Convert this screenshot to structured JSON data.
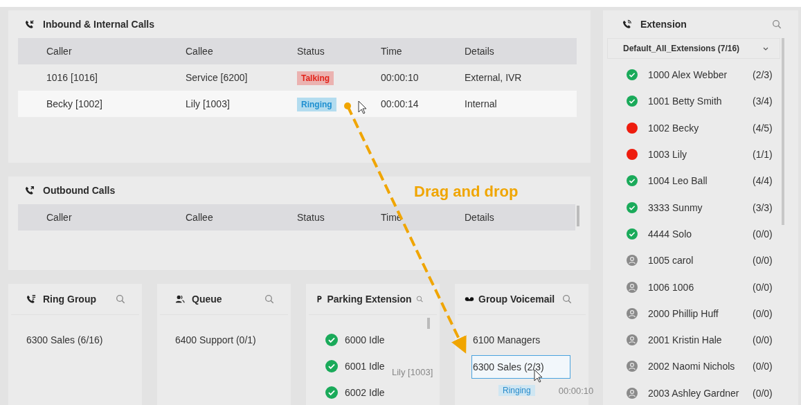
{
  "inbound": {
    "title": "Inbound & Internal Calls",
    "columns": [
      "Caller",
      "Callee",
      "Status",
      "Time",
      "Details"
    ],
    "rows": [
      {
        "caller": "1016 [1016]",
        "callee": "Service [6200]",
        "status": "Talking",
        "kind": "talking",
        "time": "00:00:10",
        "details": "External, IVR",
        "selected": false
      },
      {
        "caller": "Becky [1002]",
        "callee": "Lily [1003]",
        "status": "Ringing",
        "kind": "ringing",
        "time": "00:00:14",
        "details": "Internal",
        "selected": true
      }
    ]
  },
  "outbound": {
    "title": "Outbound Calls",
    "columns": [
      "Caller",
      "Callee",
      "Status",
      "Time",
      "Details"
    ]
  },
  "annotation": "Drag and drop",
  "cards": [
    {
      "kind": "ringgroup",
      "title": "Ring Group",
      "items": [
        {
          "label": "6300 Sales (6/16)",
          "kind": "plain",
          "drop_target": false
        }
      ]
    },
    {
      "kind": "queue",
      "title": "Queue",
      "items": [
        {
          "label": "6400 Support (0/1)",
          "kind": "plain",
          "drop_target": false
        }
      ]
    },
    {
      "kind": "parking",
      "title": "Parking Extension",
      "items": [
        {
          "label": "6000 Idle",
          "kind": "idle",
          "drop_target": false
        },
        {
          "label": "6001 Idle",
          "kind": "idle",
          "drop_target": false
        },
        {
          "label": "6002 Idle",
          "kind": "idle",
          "drop_target": false
        }
      ]
    },
    {
      "kind": "voicemail",
      "title": "Group Voicemail",
      "items": [
        {
          "label": "6100 Managers",
          "kind": "plain",
          "drop_target": false
        },
        {
          "label": "6300 Sales (2/3)",
          "kind": "plain",
          "drop_target": true
        }
      ]
    }
  ],
  "drag_ghost": {
    "callee": "Lily [1003]",
    "status": "Ringing",
    "time": "00:00:10"
  },
  "extension": {
    "title": "Extension",
    "group": "Default_All_Extensions (7/16)",
    "items": [
      {
        "label": "1000 Alex Webber",
        "count": "(2/3)",
        "kind": "idle"
      },
      {
        "label": "1001 Betty Smith",
        "count": "(3/4)",
        "kind": "idle"
      },
      {
        "label": "1002 Becky",
        "count": "(4/5)",
        "kind": "busy"
      },
      {
        "label": "1003 Lily",
        "count": "(1/1)",
        "kind": "busy"
      },
      {
        "label": "1004 Leo Ball",
        "count": "(4/4)",
        "kind": "idle"
      },
      {
        "label": "3333 Sunmy",
        "count": "(3/3)",
        "kind": "idle"
      },
      {
        "label": "4444 Solo",
        "count": "(0/0)",
        "kind": "idle"
      },
      {
        "label": "1005 carol",
        "count": "(0/0)",
        "kind": "offline"
      },
      {
        "label": "1006 1006",
        "count": "(0/0)",
        "kind": "offline"
      },
      {
        "label": "2000 Phillip Huff",
        "count": "(0/0)",
        "kind": "offline"
      },
      {
        "label": "2001 Kristin Hale",
        "count": "(0/0)",
        "kind": "offline"
      },
      {
        "label": "2002 Naomi Nichols",
        "count": "(0/0)",
        "kind": "offline"
      },
      {
        "label": "2003 Ashley Gardner",
        "count": "(0/0)",
        "kind": "offline"
      }
    ]
  }
}
